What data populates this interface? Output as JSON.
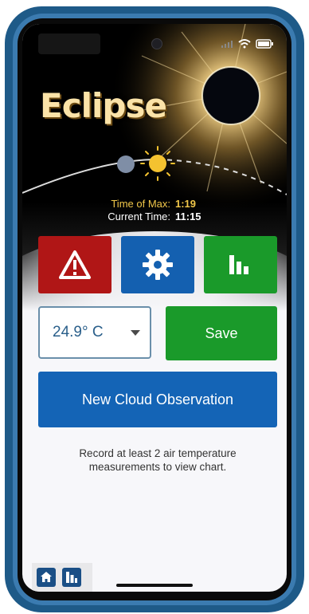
{
  "app": {
    "title": "Eclipse"
  },
  "status_bar": {
    "icons": [
      "signal-icon",
      "wifi-icon",
      "battery-icon"
    ]
  },
  "eclipse_info": {
    "time_of_max_label": "Time of Max:",
    "time_of_max_value": "1:19",
    "current_time_label": "Current Time:",
    "current_time_value": "11:15"
  },
  "action_tiles": [
    {
      "name": "warning",
      "icon": "warning-icon",
      "color": "#b01616"
    },
    {
      "name": "settings",
      "icon": "gear-icon",
      "color": "#1460b0"
    },
    {
      "name": "chart",
      "icon": "bar-chart-icon",
      "color": "#1a9a2a"
    }
  ],
  "temperature": {
    "selected": "24.9° C"
  },
  "buttons": {
    "save_label": "Save",
    "cloud_label": "New Cloud Observation"
  },
  "hint": {
    "text": "Record at least 2 air temperature measurements to view chart."
  },
  "tabbar": {
    "items": [
      "home-icon",
      "bar-chart-icon"
    ]
  }
}
